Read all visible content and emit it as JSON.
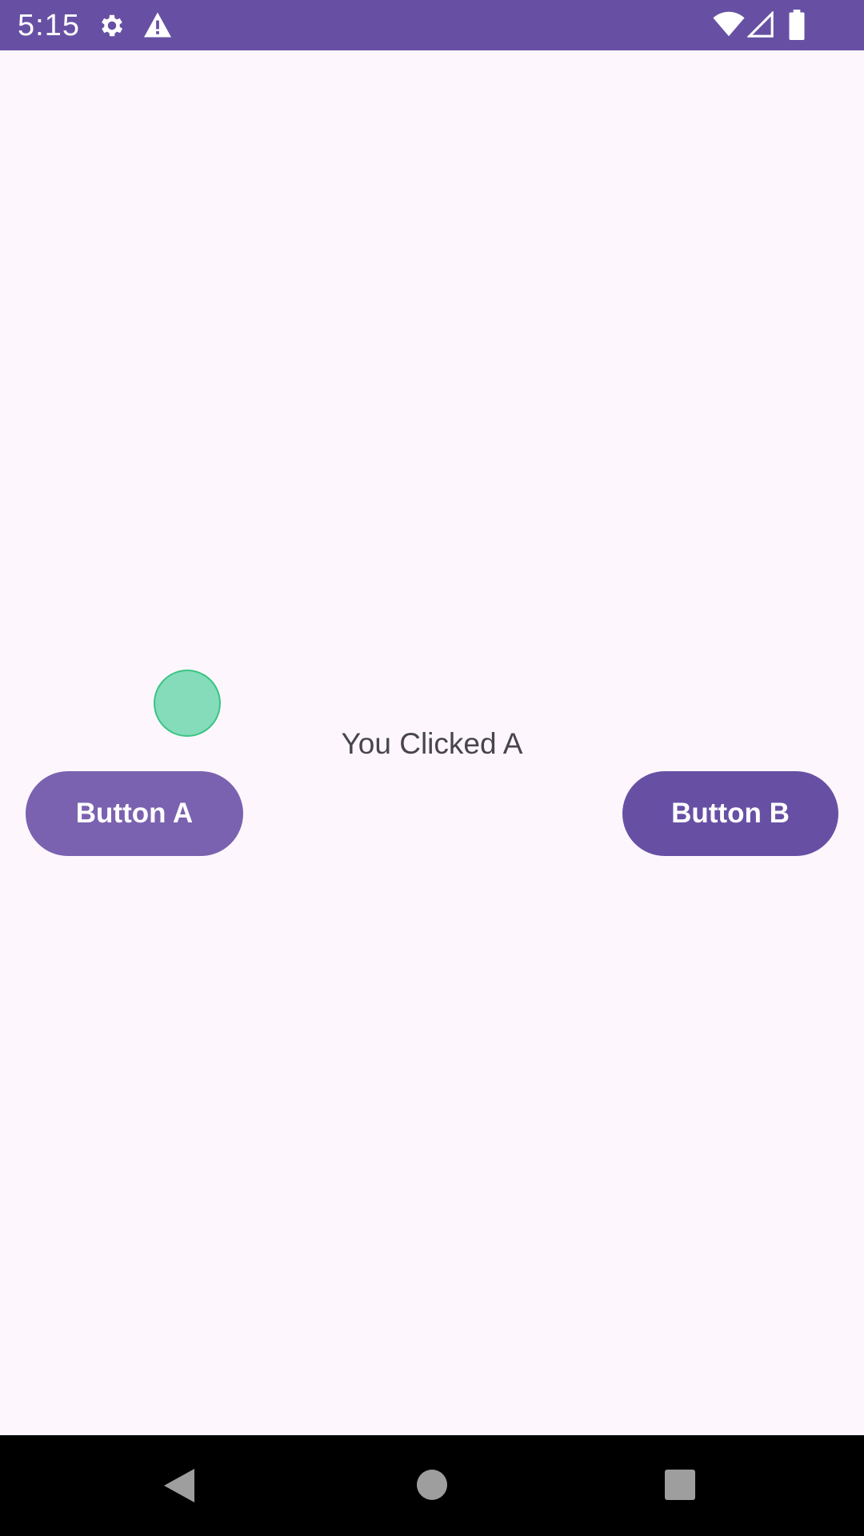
{
  "status_bar": {
    "time": "5:15",
    "icons": [
      "gear-icon",
      "warning-icon",
      "wifi-icon",
      "signal-icon",
      "battery-icon"
    ],
    "background_color": "#6750a4"
  },
  "main": {
    "result_text": "You Clicked A",
    "button_a_label": "Button A",
    "button_b_label": "Button B",
    "accent_color": "#6750a4"
  },
  "navigation_bar": {
    "buttons": [
      "back-icon",
      "home-icon",
      "recents-icon"
    ]
  }
}
